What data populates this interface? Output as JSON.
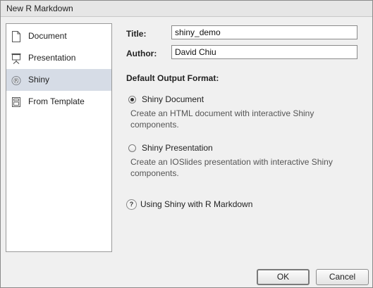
{
  "window": {
    "title": "New R Markdown"
  },
  "sidebar": {
    "items": [
      {
        "label": "Document",
        "icon": "document-icon",
        "selected": false
      },
      {
        "label": "Presentation",
        "icon": "presentation-icon",
        "selected": false
      },
      {
        "label": "Shiny",
        "icon": "shiny-icon",
        "selected": true
      },
      {
        "label": "From Template",
        "icon": "template-icon",
        "selected": false
      }
    ]
  },
  "form": {
    "title_label": "Title:",
    "title_value": "shiny_demo",
    "author_label": "Author:",
    "author_value": "David Chiu"
  },
  "output_format": {
    "heading": "Default Output Format:",
    "options": [
      {
        "label": "Shiny Document",
        "description": "Create an HTML document with interactive Shiny components.",
        "checked": true
      },
      {
        "label": "Shiny Presentation",
        "description": "Create an IOSlides presentation with interactive Shiny components.",
        "checked": false
      }
    ]
  },
  "help": {
    "icon": "help-icon",
    "label": "Using Shiny with R Markdown"
  },
  "buttons": {
    "ok": "OK",
    "cancel": "Cancel"
  },
  "colors": {
    "selected_bg": "#d6dce6",
    "dialog_bg": "#f0f0f0"
  }
}
